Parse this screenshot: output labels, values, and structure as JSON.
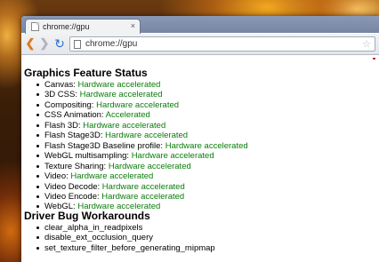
{
  "browser": {
    "tab_title": "chrome://gpu",
    "tab_close": "×",
    "url": "chrome://gpu",
    "back_glyph": "❮",
    "forward_glyph": "❯",
    "reload_glyph": "↻",
    "star_glyph": "☆"
  },
  "page": {
    "feature_heading": "Graphics Feature Status",
    "features": [
      {
        "label": "Canvas:",
        "status": "Hardware accelerated"
      },
      {
        "label": "3D CSS:",
        "status": "Hardware accelerated"
      },
      {
        "label": "Compositing:",
        "status": "Hardware accelerated"
      },
      {
        "label": "CSS Animation:",
        "status": "Accelerated"
      },
      {
        "label": "Flash 3D:",
        "status": "Hardware accelerated"
      },
      {
        "label": "Flash Stage3D:",
        "status": "Hardware accelerated"
      },
      {
        "label": "Flash Stage3D Baseline profile:",
        "status": "Hardware accelerated"
      },
      {
        "label": "WebGL multisampling:",
        "status": "Hardware accelerated"
      },
      {
        "label": "Texture Sharing:",
        "status": "Hardware accelerated"
      },
      {
        "label": "Video:",
        "status": "Hardware accelerated"
      },
      {
        "label": "Video Decode:",
        "status": "Hardware accelerated"
      },
      {
        "label": "Video Encode:",
        "status": "Hardware accelerated"
      },
      {
        "label": "WebGL:",
        "status": "Hardware accelerated"
      }
    ],
    "bug_heading": "Driver Bug Workarounds",
    "workarounds": [
      "clear_alpha_in_readpixels",
      "disable_ext_occlusion_query",
      "set_texture_filter_before_generating_mipmap"
    ]
  },
  "colors": {
    "status_green": "#0a7d0a",
    "tabstrip": "#7f8fab"
  }
}
